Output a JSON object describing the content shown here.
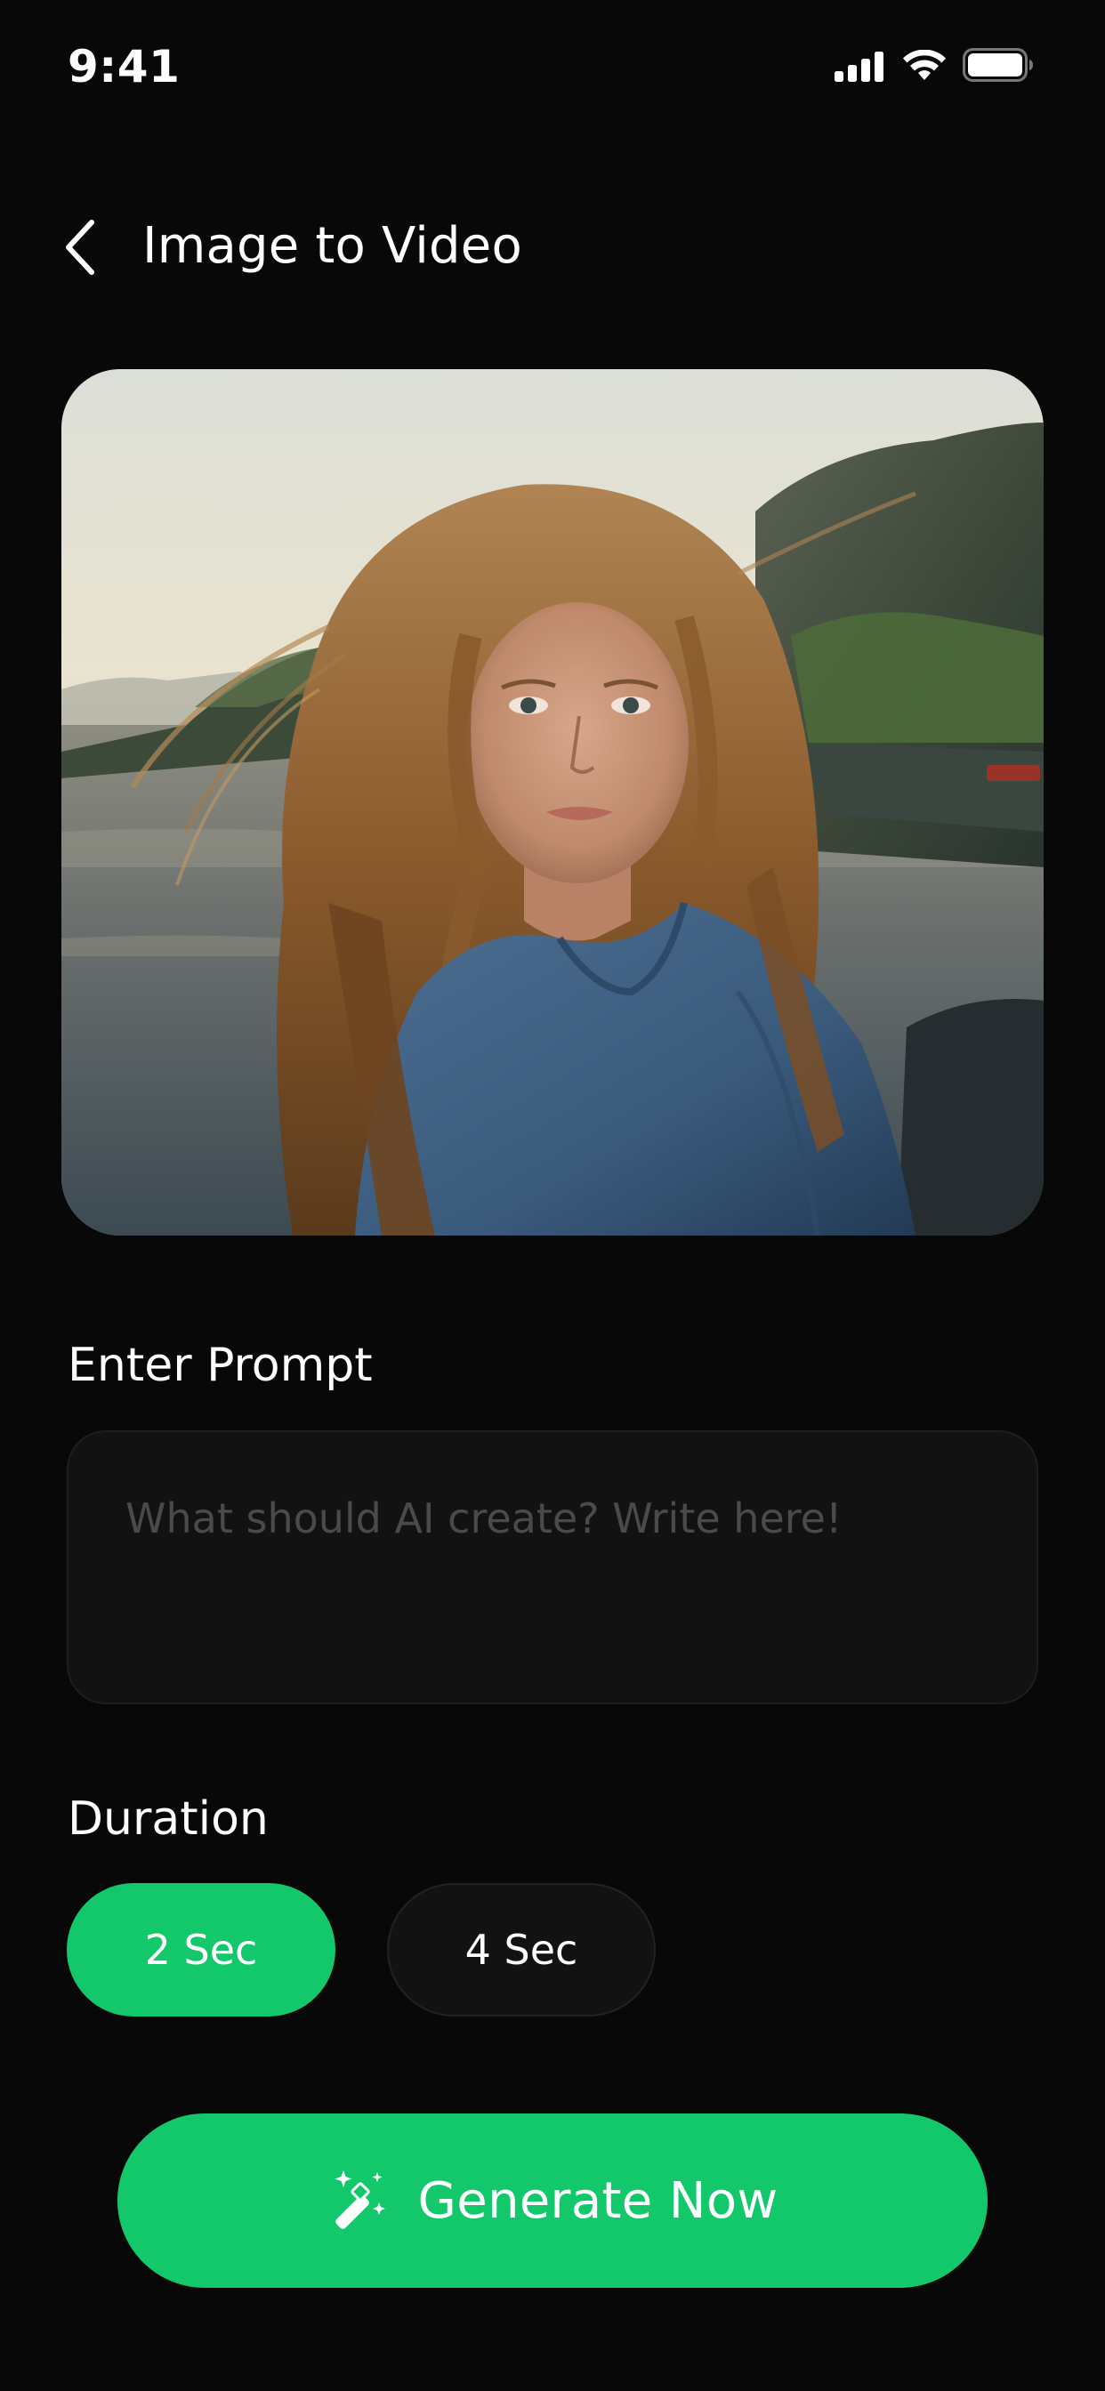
{
  "status_bar": {
    "time": "9:41",
    "icons": [
      "signal-icon",
      "wifi-icon",
      "battery-icon"
    ]
  },
  "header": {
    "back_icon": "chevron-left-icon",
    "title": "Image to Video"
  },
  "image_card": {
    "content": "portrait-photo"
  },
  "prompt": {
    "label": "Enter Prompt",
    "value": "",
    "placeholder": "What should AI create? Write here!"
  },
  "duration": {
    "label": "Duration",
    "options": [
      {
        "label": "2 Sec",
        "selected": true
      },
      {
        "label": "4 Sec",
        "selected": false
      }
    ]
  },
  "generate": {
    "icon": "magic-wand-icon",
    "label": "Generate Now"
  },
  "colors": {
    "background": "#080808",
    "accent": "#13c86a",
    "field_bg": "#121212",
    "placeholder": "#4a4a4a"
  }
}
